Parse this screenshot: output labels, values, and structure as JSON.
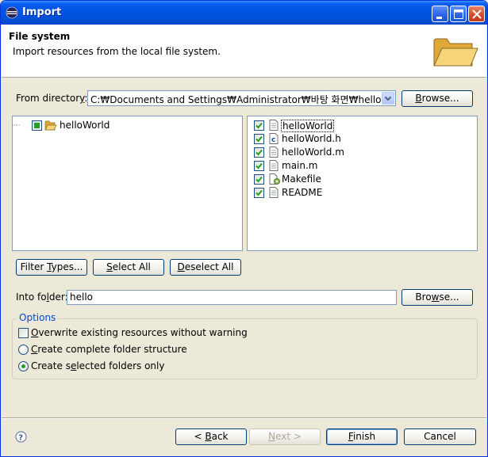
{
  "window": {
    "title": "Import",
    "controls": {
      "minimize": "minimize",
      "maximize": "maximize",
      "close": "close"
    }
  },
  "header": {
    "title": "File system",
    "description": "Import resources from the local file system."
  },
  "from_directory": {
    "label_pre": "From director",
    "label_mnemonic": "y",
    "label_post": ":",
    "value": "C:₩Documents and Settings₩Administrator₩바탕 화면₩hellowo",
    "browse": {
      "pre": "",
      "mn": "B",
      "post": "rowse..."
    }
  },
  "tree": {
    "items": [
      {
        "label": "helloWorld",
        "state": "partial"
      }
    ]
  },
  "files": [
    {
      "name": "helloWorld",
      "icon": "text-file-icon",
      "checked": true,
      "selected": true
    },
    {
      "name": "helloWorld.h",
      "icon": "c-header-file-icon",
      "checked": true
    },
    {
      "name": "helloWorld.m",
      "icon": "text-file-icon",
      "checked": true
    },
    {
      "name": "main.m",
      "icon": "text-file-icon",
      "checked": true
    },
    {
      "name": "Makefile",
      "icon": "makefile-icon",
      "checked": true
    },
    {
      "name": "README",
      "icon": "text-file-icon",
      "checked": true
    }
  ],
  "selection_buttons": {
    "filter": {
      "pre": "Filter ",
      "mn": "T",
      "post": "ypes..."
    },
    "select_all": {
      "pre": "",
      "mn": "S",
      "post": "elect All"
    },
    "deselect_all": {
      "pre": "",
      "mn": "D",
      "post": "eselect All"
    }
  },
  "into_folder": {
    "label_pre": "Into fo",
    "label_mnemonic": "l",
    "label_post": "der:",
    "value": "hello",
    "browse": {
      "pre": "Bro",
      "mn": "w",
      "post": "se..."
    }
  },
  "options": {
    "title": "Options",
    "overwrite": {
      "pre": "",
      "mn": "O",
      "post": "verwrite existing resources without warning",
      "checked": false
    },
    "complete": {
      "pre": "",
      "mn": "C",
      "post": "reate complete folder structure",
      "selected": false
    },
    "selected_only": {
      "pre": "Create s",
      "mn": "e",
      "post": "lected folders only",
      "selected": true
    }
  },
  "footer": {
    "back": {
      "pre": "< ",
      "mn": "B",
      "post": "ack"
    },
    "next": {
      "pre": "",
      "mn": "N",
      "post": "ext >"
    },
    "finish": {
      "pre": "",
      "mn": "F",
      "post": "inish"
    },
    "cancel": "Cancel"
  },
  "colors": {
    "titlebar": "#0053e1",
    "dialog_bg": "#ece9d8",
    "group_title": "#0046d5",
    "check": "#21a121"
  }
}
